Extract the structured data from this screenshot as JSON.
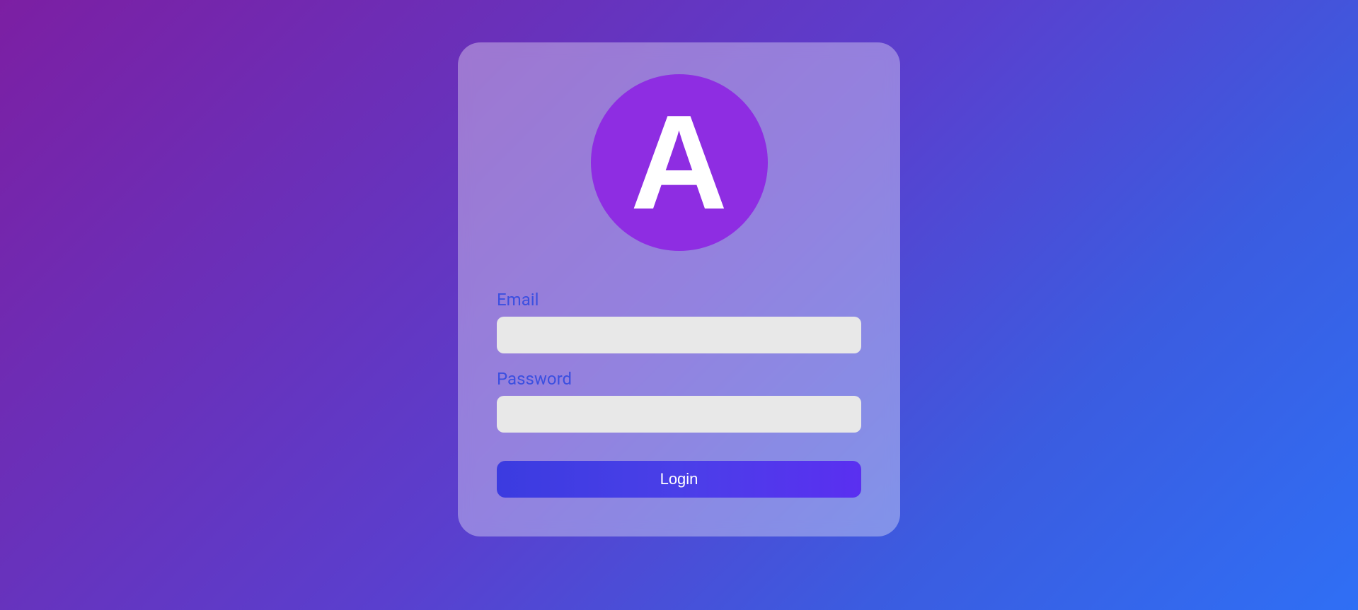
{
  "logo": {
    "letter": "A"
  },
  "form": {
    "email": {
      "label": "Email",
      "value": ""
    },
    "password": {
      "label": "Password",
      "value": ""
    },
    "submit_label": "Login"
  }
}
